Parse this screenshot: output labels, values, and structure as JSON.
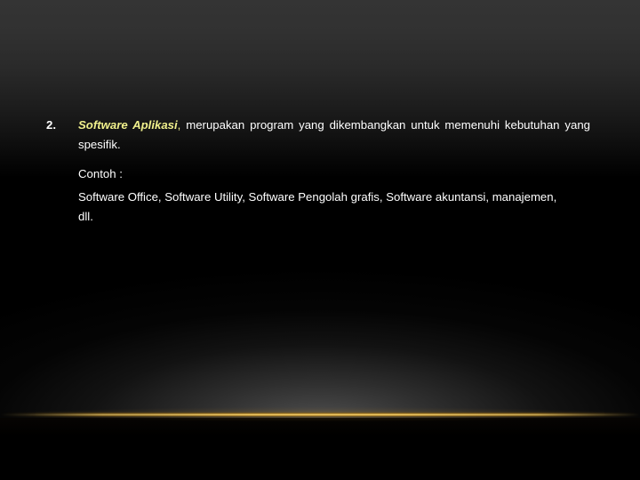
{
  "slide": {
    "background": {
      "top_color": "#343434",
      "base_color": "#000000",
      "accent_line_color": "#f7d678",
      "glow_color": "#808080"
    },
    "accent_text_color": "#f0f08c",
    "body_text_color": "#ffffff"
  },
  "body": {
    "bullets": [
      {
        "marker": "2.",
        "keyword": "Software Aplikasi",
        "keyword_punctuation": ",",
        "text": " merupakan program yang dikembangkan untuk memenuhi kebutuhan yang spesifik."
      }
    ],
    "sub_blocks": [
      {
        "label": "Contoh :"
      },
      {
        "label": "Software Office, Software Utility, Software Pengolah grafis, Software akuntansi, manajemen, dll."
      }
    ]
  }
}
